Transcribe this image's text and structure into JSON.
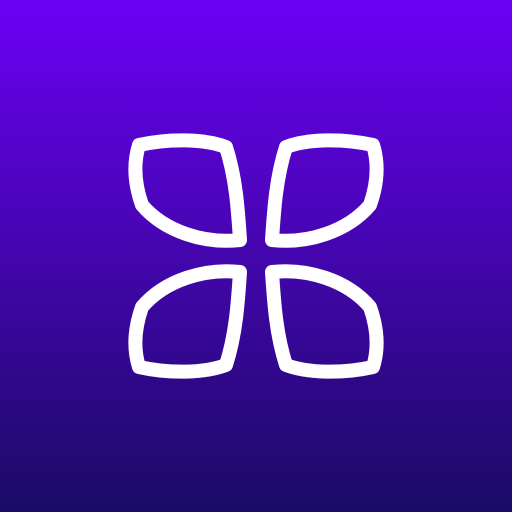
{
  "icon": {
    "name": "four-petal-logo",
    "colors": {
      "gradient_top": "#6c00f5",
      "gradient_bottom": "#1a0b64",
      "stroke": "#ffffff"
    }
  }
}
